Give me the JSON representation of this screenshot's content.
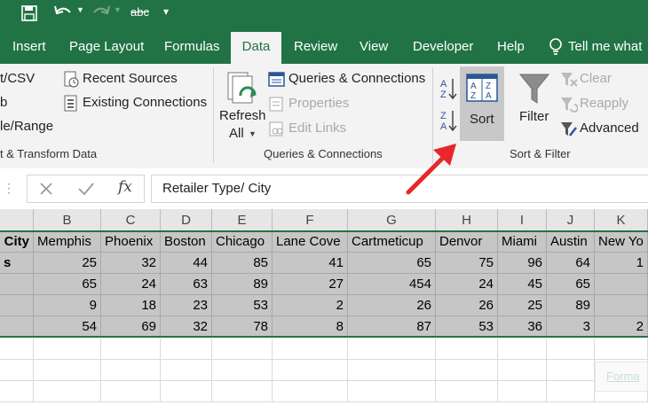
{
  "quick_access": {
    "save_icon": "save-icon",
    "undo_icon": "undo-icon",
    "redo_icon": "redo-icon",
    "spelling_label": "abc"
  },
  "tabs": [
    "Insert",
    "Page Layout",
    "Formulas",
    "Data",
    "Review",
    "View",
    "Developer",
    "Help"
  ],
  "tell_me": "Tell me what",
  "ribbon": {
    "get_transform": {
      "items": [
        "t/CSV",
        "b",
        "le/Range"
      ],
      "recent_sources": "Recent Sources",
      "existing_connections": "Existing Connections",
      "group_label": "t & Transform Data"
    },
    "queries": {
      "refresh_line1": "Refresh",
      "refresh_line2": "All",
      "queries_connections": "Queries & Connections",
      "properties": "Properties",
      "edit_links": "Edit Links",
      "group_label": "Queries & Connections"
    },
    "sort_filter": {
      "sort": "Sort",
      "filter": "Filter",
      "clear": "Clear",
      "reapply": "Reapply",
      "advanced": "Advanced",
      "group_label": "Sort & Filter",
      "sort_icon_letters": [
        "A",
        "Z",
        "Z",
        "A"
      ],
      "az_top": "A",
      "az_bottom": "Z",
      "za_top": "Z",
      "za_bottom": "A"
    }
  },
  "formula_bar": {
    "fx": "fx",
    "content": "Retailer Type/ City"
  },
  "sheet": {
    "columns": [
      "B",
      "C",
      "D",
      "E",
      "F",
      "G",
      "H",
      "I",
      "J",
      "K"
    ],
    "header_row": [
      "City",
      "Memphis",
      "Phoenix",
      "Boston",
      "Chicago",
      "Lane Cove",
      "Cartmeticup",
      "Denvor",
      "Miami",
      "Austin",
      "New Yo"
    ],
    "rows": [
      {
        "label": "s",
        "values": [
          "25",
          "32",
          "44",
          "85",
          "41",
          "65",
          "75",
          "96",
          "64",
          "1"
        ]
      },
      {
        "label": "",
        "values": [
          "65",
          "24",
          "63",
          "89",
          "27",
          "454",
          "24",
          "45",
          "65",
          ""
        ]
      },
      {
        "label": "",
        "values": [
          "9",
          "18",
          "23",
          "53",
          "2",
          "26",
          "26",
          "25",
          "89",
          ""
        ]
      },
      {
        "label": "",
        "values": [
          "54",
          "69",
          "32",
          "78",
          "8",
          "87",
          "53",
          "36",
          "3",
          "2"
        ]
      }
    ],
    "quick_analysis_label": "Forma"
  },
  "colors": {
    "excel_green": "#217346",
    "selection": "#c6c6c6",
    "arrow": "#e8262d"
  }
}
